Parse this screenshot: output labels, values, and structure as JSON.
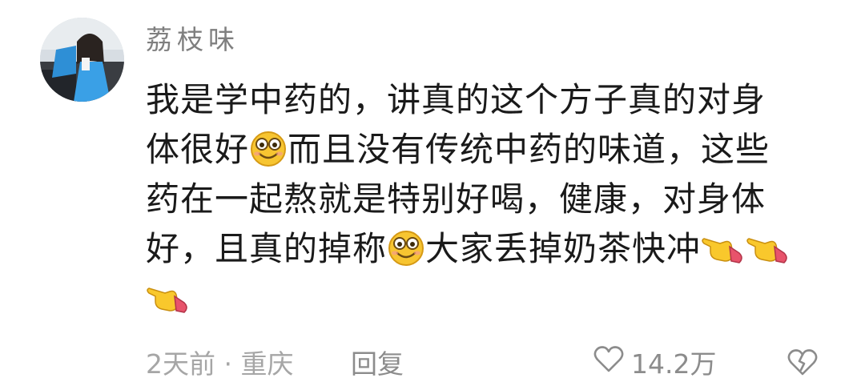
{
  "comment": {
    "username": "荔枝味",
    "lines": [
      [
        "我是学中药的，讲真的这个方子真的对身"
      ],
      [
        "体很好",
        "{smile}",
        "而且没有传统中药的味道，这些"
      ],
      [
        "药在一起熬就是特别好喝，健康，对身体"
      ],
      [
        "好，且真的掉称",
        "{smile}",
        "大家丢掉奶茶快冲",
        "{point}",
        "{point}"
      ],
      [
        "{point}"
      ]
    ],
    "line1": "我是学中药的，讲真的这个方子真的对身",
    "line2a": "体很好",
    "line2b": "而且没有传统中药的味道，这些",
    "line3": "药在一起熬就是特别好喝，健康，对身体",
    "line4a": "好，且真的掉称",
    "line4b": "大家丢掉奶茶快冲",
    "time": "2天前",
    "separator": "·",
    "location": "重庆",
    "reply_label": "回复",
    "like_count": "14.2万",
    "emoji_names": [
      "smile-emoji",
      "point-right-emoji"
    ],
    "colors": {
      "username": "#7f7f7f",
      "body_text": "#1a1a1a",
      "meta_text": "#a6a6a6",
      "emoji_face": "#f7c531",
      "point_hand": "#f9c82c",
      "point_cuff": "#e8536b"
    }
  }
}
